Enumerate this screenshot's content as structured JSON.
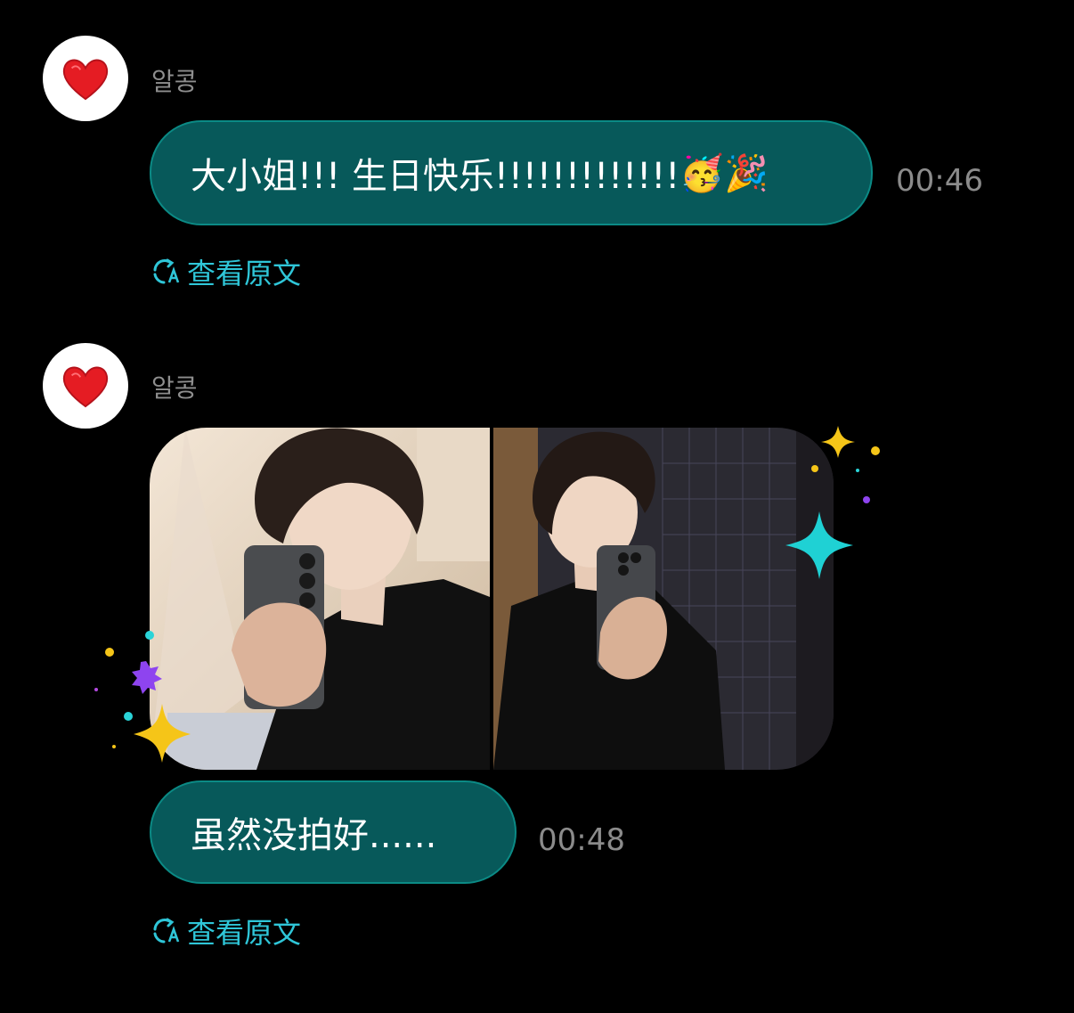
{
  "messages": [
    {
      "sender": "알콩",
      "text": "大小姐!!! 生日快乐!!!!!!!!!!!!!",
      "emoji": "🥳🎉",
      "time": "00:46",
      "translate_label": "查看原文"
    },
    {
      "sender": "알콩",
      "photos": [
        "mirror-selfie-left",
        "mirror-selfie-right"
      ],
      "text": "虽然没拍好......",
      "time": "00:48",
      "translate_label": "查看原文"
    }
  ],
  "colors": {
    "background": "#000000",
    "bubble": "#07595a",
    "bubble_border": "#0b8a85",
    "link": "#2fc6d8",
    "meta_text": "#8b8b8b"
  },
  "icons": {
    "avatar": "red-heart-icon",
    "translate": "translate-icon"
  }
}
